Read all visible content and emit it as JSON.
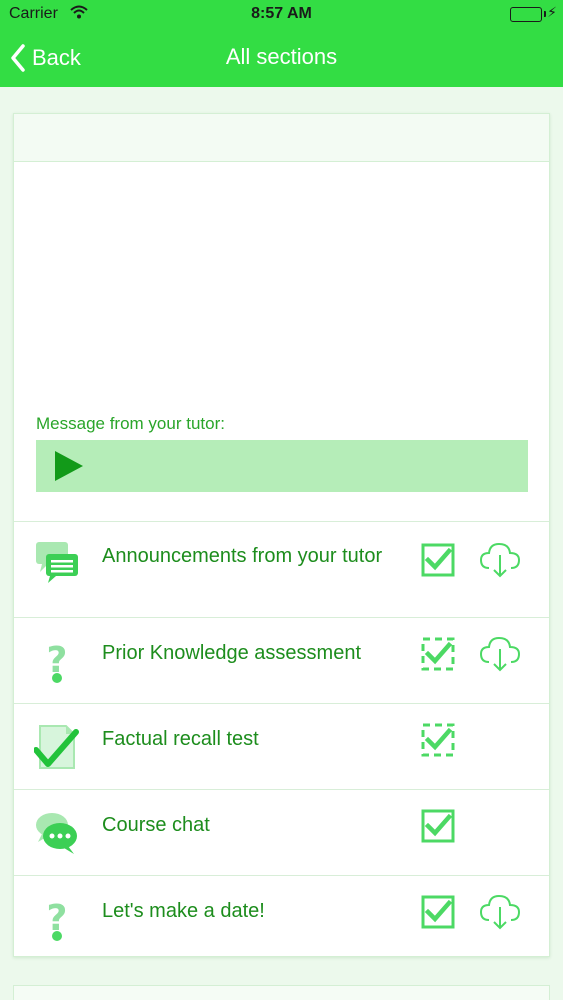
{
  "status_bar": {
    "carrier": "Carrier",
    "time": "8:57 AM"
  },
  "nav": {
    "back_label": "Back",
    "title": "All sections"
  },
  "tutor_message": {
    "label": "Message from your tutor:"
  },
  "sections": [
    {
      "label": "Announcements from your tutor",
      "icon": "chat-bubbles-icon",
      "check": "checked",
      "download": true
    },
    {
      "label": "Prior Knowledge assessment",
      "icon": "question-mark-icon",
      "check": "dashed-checked",
      "download": true
    },
    {
      "label": "Factual recall test",
      "icon": "document-check-icon",
      "check": "dashed-checked",
      "download": false
    },
    {
      "label": "Course chat",
      "icon": "chat-dots-icon",
      "check": "checked",
      "download": false
    },
    {
      "label": "Let's make a date!",
      "icon": "question-mark-icon",
      "check": "checked",
      "download": true
    }
  ],
  "colors": {
    "nav_bg": "#33dd44",
    "text_green": "#1d8d1d",
    "icon_green": "#4cd964",
    "audio_bar": "#b5edb8",
    "page_bg": "#ecf9ec"
  }
}
